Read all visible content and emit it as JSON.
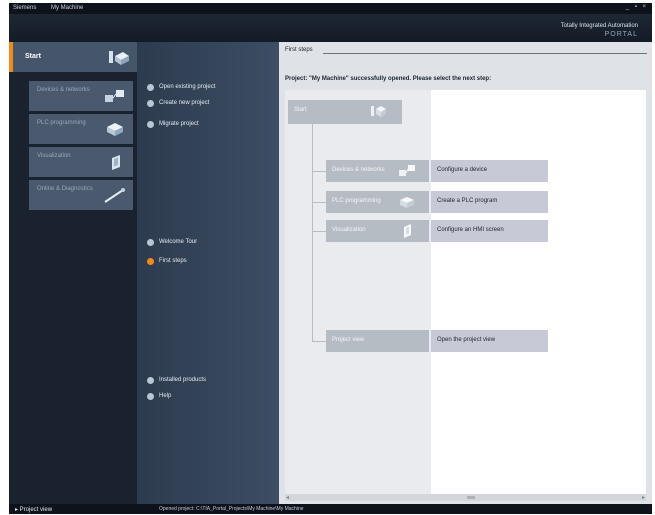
{
  "window": {
    "app_name": "Siemens",
    "project": "My Machine",
    "controls": "_ ▪ ×"
  },
  "brand": {
    "line1": "Totally Integrated Automation",
    "line2": "PORTAL"
  },
  "portal": {
    "start_label": "Start",
    "items": [
      {
        "label": "Devices & networks",
        "icon": "network-devices-icon"
      },
      {
        "label": "PLC programming",
        "icon": "plc-block-icon"
      },
      {
        "label": "Visualization",
        "icon": "hmi-panel-icon"
      },
      {
        "label": "Online & Diagnostics",
        "icon": "diagnostics-probe-icon"
      }
    ]
  },
  "actions": {
    "top": [
      {
        "label": "Open existing project"
      },
      {
        "label": "Create new project"
      },
      {
        "label": "Migrate project"
      }
    ],
    "middle": [
      {
        "label": "Welcome Tour"
      },
      {
        "label": "First steps"
      }
    ],
    "bottom": [
      {
        "label": "Installed products"
      },
      {
        "label": "Help"
      }
    ]
  },
  "content": {
    "title": "First steps",
    "status": "Project: \"My Machine\" successfully opened. Please select the next step:",
    "root_label": "Start",
    "steps": [
      {
        "label": "Devices & networks",
        "description": "Configure a device",
        "icon": "network-devices-icon"
      },
      {
        "label": "PLC programming",
        "description": "Create a PLC program",
        "icon": "plc-block-icon"
      },
      {
        "label": "Visualization",
        "description": "Configure an HMI screen",
        "icon": "hmi-panel-icon"
      },
      {
        "label": "Project view",
        "description": "Open the project view",
        "icon": ""
      }
    ],
    "scroll_left": "◂",
    "scroll_right": "▸"
  },
  "footer": {
    "project_view": "▸ Project view",
    "status_bar": "Opened project: C:\\TIA_Portal_Projects\\My Machine\\My Machine"
  },
  "colors": {
    "accent": "#f08a1c",
    "portal_bg": "#1a2230",
    "action_bg": "#3c4e64"
  }
}
